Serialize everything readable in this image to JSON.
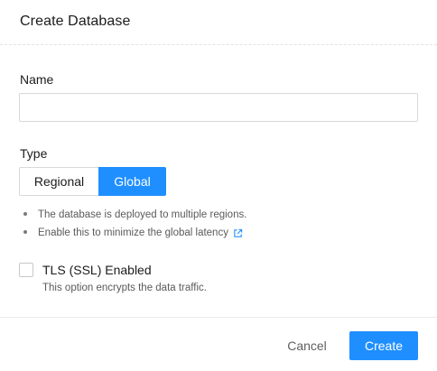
{
  "dialog": {
    "title": "Create Database"
  },
  "name_field": {
    "label": "Name",
    "value": "",
    "placeholder": ""
  },
  "type_field": {
    "label": "Type",
    "options": [
      {
        "label": "Regional",
        "selected": false
      },
      {
        "label": "Global",
        "selected": true
      }
    ],
    "bullets": [
      "The database is deployed to multiple regions.",
      "Enable this to minimize the global latency"
    ],
    "external_link_icon": "external-link-icon"
  },
  "tls": {
    "label": "TLS (SSL) Enabled",
    "description": "This option encrypts the data traffic.",
    "checked": false
  },
  "footer": {
    "cancel_label": "Cancel",
    "create_label": "Create"
  },
  "colors": {
    "primary": "#1f8fff",
    "border": "#d9d9d9",
    "muted_text": "#5a5a5a"
  }
}
